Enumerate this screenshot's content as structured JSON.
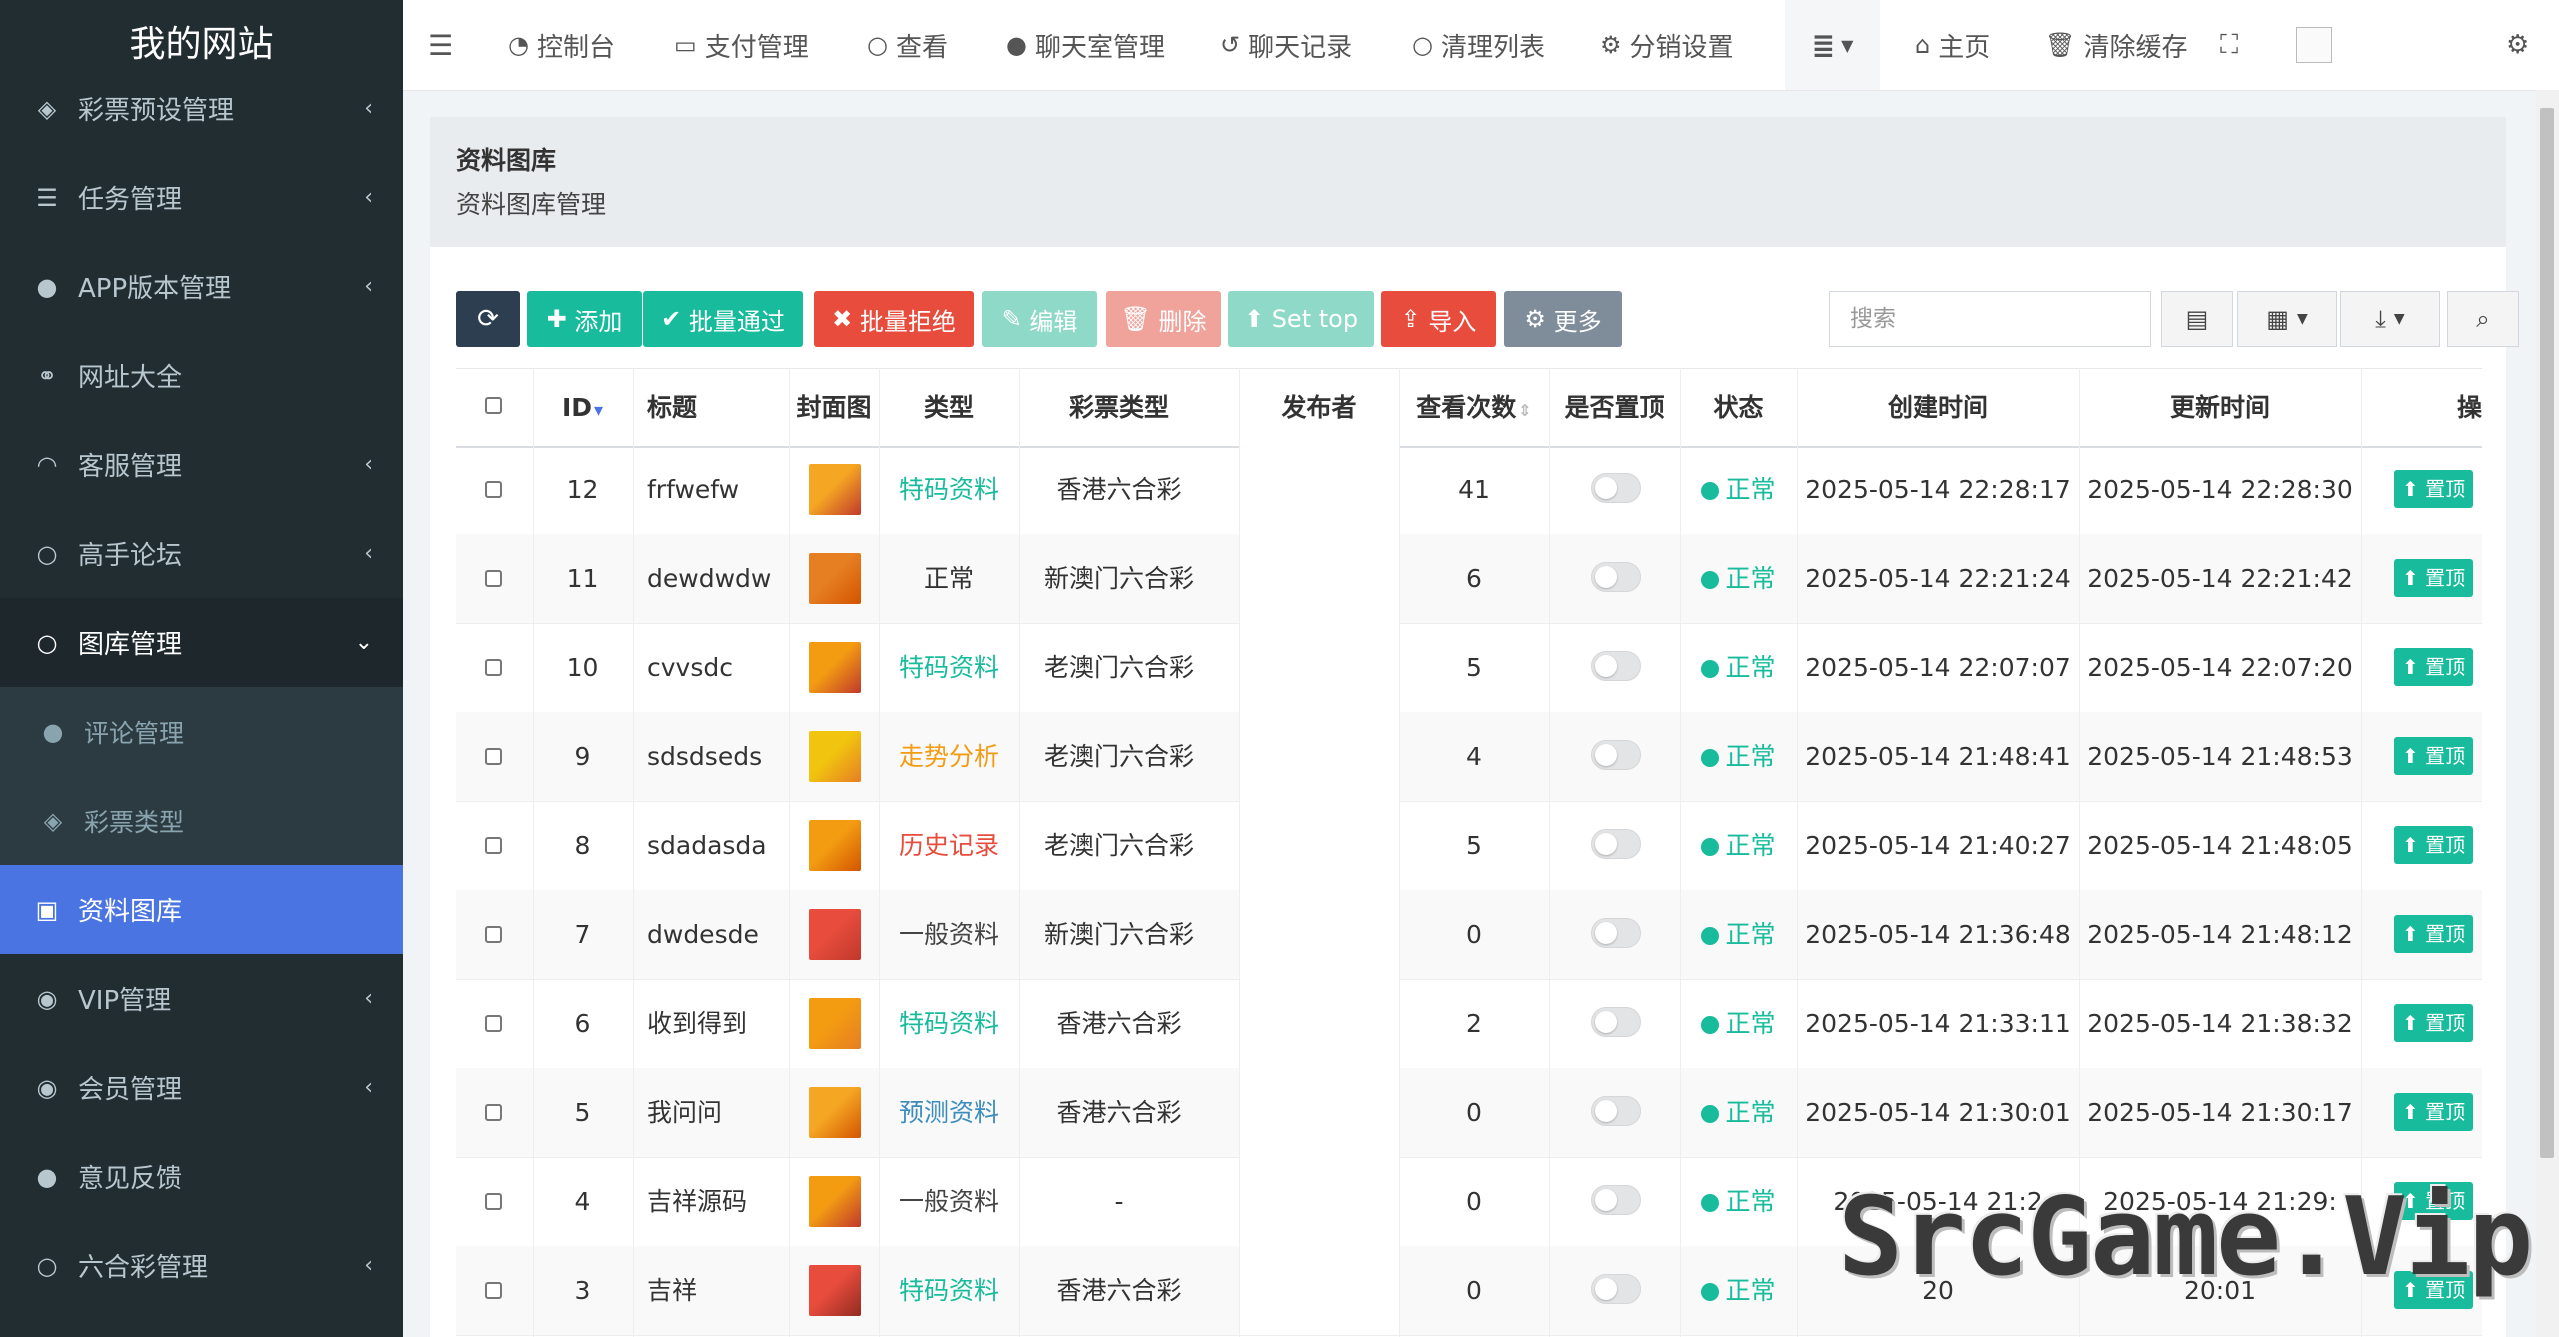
{
  "sidebar": {
    "brand": "我的网站",
    "items": [
      {
        "label": "彩票预设管理",
        "icon": "tag-icon",
        "state": "collapsed"
      },
      {
        "label": "任务管理",
        "icon": "tasks-icon",
        "state": "collapsed"
      },
      {
        "label": "APP版本管理",
        "icon": "android-icon",
        "state": "collapsed"
      },
      {
        "label": "网址大全",
        "icon": "link-icon",
        "state": "leaf"
      },
      {
        "label": "客服管理",
        "icon": "headset-icon",
        "state": "collapsed"
      },
      {
        "label": "高手论坛",
        "icon": "circle-icon",
        "state": "collapsed"
      },
      {
        "label": "图库管理",
        "icon": "circle-icon",
        "state": "expanded"
      },
      {
        "label": "评论管理",
        "icon": "comments-icon",
        "state": "sub"
      },
      {
        "label": "彩票类型",
        "icon": "tag-icon",
        "state": "sub"
      },
      {
        "label": "资料图库",
        "icon": "image-icon",
        "state": "active"
      },
      {
        "label": "VIP管理",
        "icon": "gamepad-icon",
        "state": "collapsed"
      },
      {
        "label": "会员管理",
        "icon": "user-circle-icon",
        "state": "collapsed"
      },
      {
        "label": "意见反馈",
        "icon": "comment-icon",
        "state": "leaf"
      },
      {
        "label": "六合彩管理",
        "icon": "circle-icon",
        "state": "collapsed"
      }
    ]
  },
  "topnav": {
    "items": [
      {
        "label": "控制台",
        "icon": "dashboard-icon"
      },
      {
        "label": "支付管理",
        "icon": "credit-card-icon"
      },
      {
        "label": "查看",
        "icon": "circle-icon"
      },
      {
        "label": "聊天室管理",
        "icon": "comment-icon"
      },
      {
        "label": "聊天记录",
        "icon": "history-icon"
      },
      {
        "label": "清理列表",
        "icon": "circle-icon"
      },
      {
        "label": "分销设置",
        "icon": "cogs-icon"
      }
    ],
    "home_label": "主页",
    "clear_cache_label": "清除缓存"
  },
  "header": {
    "title": "资料图库",
    "subtitle": "资料图库管理"
  },
  "toolbar": {
    "add": "添加",
    "batch_pass": "批量通过",
    "batch_reject": "批量拒绝",
    "edit": "编辑",
    "delete": "删除",
    "set_top": "Set top",
    "import": "导入",
    "more": "更多",
    "search_placeholder": "搜索"
  },
  "table": {
    "columns": [
      "ID",
      "标题",
      "封面图",
      "类型",
      "彩票类型",
      "发布者",
      "查看次数",
      "是否置顶",
      "状态",
      "创建时间",
      "更新时间",
      "操"
    ],
    "top_button_label": "置顶",
    "rows": [
      {
        "id": "12",
        "title": "frfwefw",
        "type": "特码资料",
        "type_color": "#18bc9c",
        "lottery": "香港六合彩",
        "publisher": "",
        "views": "41",
        "status": "正常",
        "created": "2025-05-14 22:28:17",
        "updated": "2025-05-14 22:28:30"
      },
      {
        "id": "11",
        "title": "dewdwdw",
        "type": "正常",
        "type_color": "#333333",
        "lottery": "新澳门六合彩",
        "publisher": "",
        "views": "6",
        "status": "正常",
        "created": "2025-05-14 22:21:24",
        "updated": "2025-05-14 22:21:42"
      },
      {
        "id": "10",
        "title": "cvvsdc",
        "type": "特码资料",
        "type_color": "#18bc9c",
        "lottery": "老澳门六合彩",
        "publisher": "",
        "views": "5",
        "status": "正常",
        "created": "2025-05-14 22:07:07",
        "updated": "2025-05-14 22:07:20"
      },
      {
        "id": "9",
        "title": "sdsdseds",
        "type": "走势分析",
        "type_color": "#f39c12",
        "lottery": "老澳门六合彩",
        "publisher": "",
        "views": "4",
        "status": "正常",
        "created": "2025-05-14 21:48:41",
        "updated": "2025-05-14 21:48:53"
      },
      {
        "id": "8",
        "title": "sdadasda",
        "type": "历史记录",
        "type_color": "#e74c3c",
        "lottery": "老澳门六合彩",
        "publisher": "",
        "views": "5",
        "status": "正常",
        "created": "2025-05-14 21:40:27",
        "updated": "2025-05-14 21:48:05"
      },
      {
        "id": "7",
        "title": "dwdesde",
        "type": "一般资料",
        "type_color": "#444444",
        "lottery": "新澳门六合彩",
        "publisher": "",
        "views": "0",
        "status": "正常",
        "created": "2025-05-14 21:36:48",
        "updated": "2025-05-14 21:48:12"
      },
      {
        "id": "6",
        "title": "收到得到",
        "type": "特码资料",
        "type_color": "#18bc9c",
        "lottery": "香港六合彩",
        "publisher": "",
        "views": "2",
        "status": "正常",
        "created": "2025-05-14 21:33:11",
        "updated": "2025-05-14 21:38:32"
      },
      {
        "id": "5",
        "title": "我问问",
        "type": "预测资料",
        "type_color": "#3c8dbc",
        "lottery": "香港六合彩",
        "publisher": "",
        "views": "0",
        "status": "正常",
        "created": "2025-05-14 21:30:01",
        "updated": "2025-05-14 21:30:17"
      },
      {
        "id": "4",
        "title": "吉祥源码",
        "type": "一般资料",
        "type_color": "#444444",
        "lottery": "-",
        "publisher": "",
        "views": "0",
        "status": "正常",
        "created": "2025-05-14 21:2",
        "updated": "2025-05-14 21:29:"
      },
      {
        "id": "3",
        "title": "吉祥",
        "type": "特码资料",
        "type_color": "#18bc9c",
        "lottery": "香港六合彩",
        "publisher": "",
        "views": "0",
        "status": "正常",
        "created": "20",
        "updated": "20:01"
      }
    ]
  },
  "watermark": "SrcGame.Vip",
  "colors": {
    "sidebar_bg": "#222d32",
    "active": "#4b74e3",
    "success": "#18bc9c",
    "danger": "#e74c3c",
    "primary_dark": "#2c3e50"
  }
}
